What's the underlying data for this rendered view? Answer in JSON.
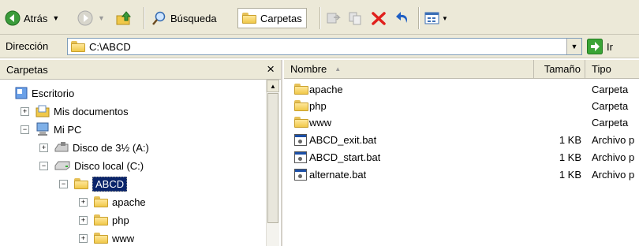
{
  "toolbar": {
    "back_label": "Atrás",
    "search_label": "Búsqueda",
    "folders_label": "Carpetas"
  },
  "address": {
    "label": "Dirección",
    "value": "C:\\ABCD",
    "go_label": "Ir"
  },
  "folders_pane": {
    "title": "Carpetas",
    "close": "×",
    "items": [
      {
        "label": "Escritorio",
        "icon": "desktop-icon"
      },
      {
        "label": "Mis documentos",
        "icon": "my-documents-icon"
      },
      {
        "label": "Mi PC",
        "icon": "my-computer-icon"
      },
      {
        "label": "Disco de 3½ (A:)",
        "icon": "floppy-drive-icon"
      },
      {
        "label": "Disco local (C:)",
        "icon": "hard-drive-icon"
      },
      {
        "label": "ABCD",
        "icon": "folder-open-icon",
        "selected": true
      },
      {
        "label": "apache",
        "icon": "folder-icon"
      },
      {
        "label": "php",
        "icon": "folder-icon"
      },
      {
        "label": "www",
        "icon": "folder-icon"
      }
    ]
  },
  "file_list": {
    "columns": {
      "name": "Nombre",
      "size": "Tamaño",
      "type": "Tipo"
    },
    "rows": [
      {
        "name": "apache",
        "size": "",
        "type": "Carpeta",
        "icon": "folder-icon"
      },
      {
        "name": "php",
        "size": "",
        "type": "Carpeta",
        "icon": "folder-icon"
      },
      {
        "name": "www",
        "size": "",
        "type": "Carpeta",
        "icon": "folder-icon"
      },
      {
        "name": "ABCD_exit.bat",
        "size": "1 KB",
        "type": "Archivo p",
        "icon": "batch-file-icon"
      },
      {
        "name": "ABCD_start.bat",
        "size": "1 KB",
        "type": "Archivo p",
        "icon": "batch-file-icon"
      },
      {
        "name": "alternate.bat",
        "size": "1 KB",
        "type": "Archivo p",
        "icon": "batch-file-icon"
      }
    ]
  },
  "colors": {
    "selection": "#0a246a",
    "chrome": "#ece9d8",
    "delete_red": "#e0201c",
    "go_green": "#3aa436"
  }
}
